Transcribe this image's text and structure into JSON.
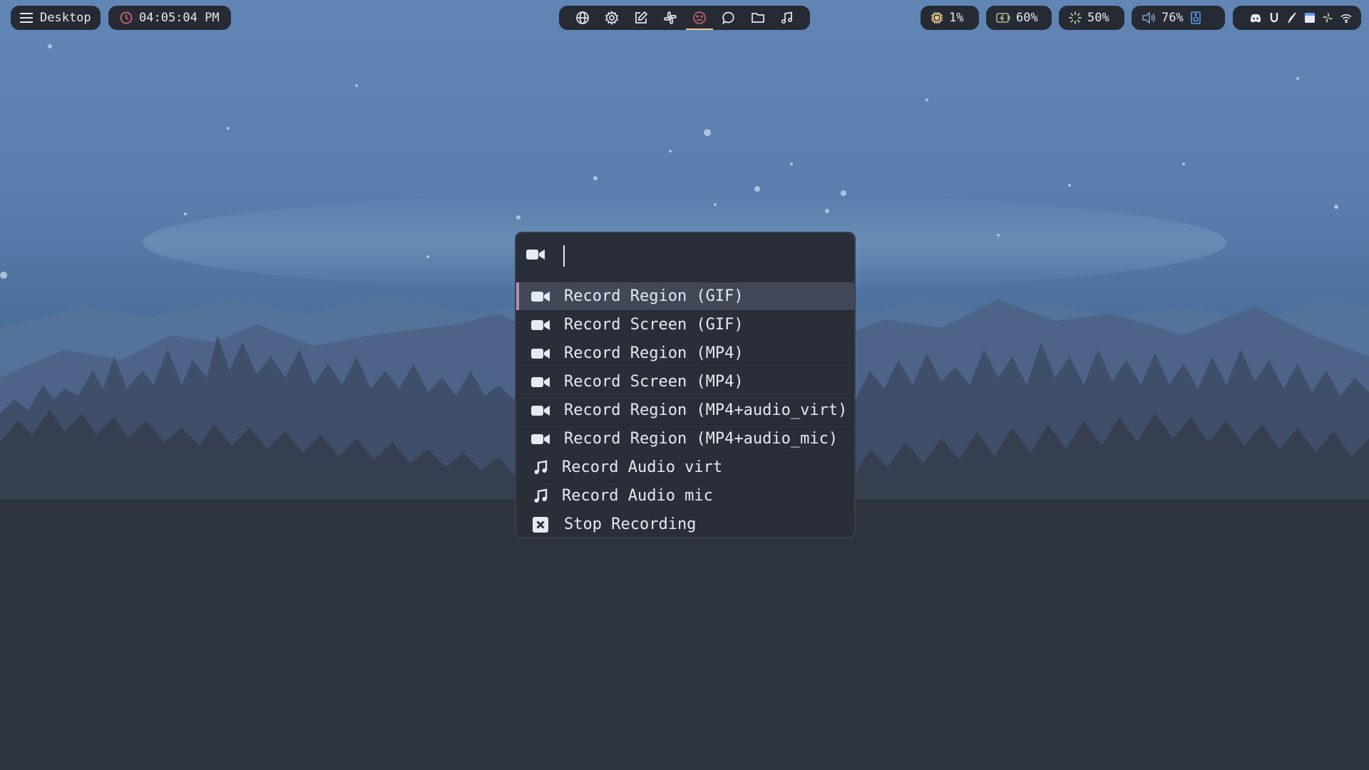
{
  "colors": {
    "sky_top": "#5f84b4",
    "sky_mid": "#4a6d9a",
    "bar_bg": "#252a35",
    "menu_bg": "#2a2e39",
    "menu_selected": "#434858",
    "menu_accent": "#b48ead",
    "active_underline": "#ebcb8b",
    "cpu_icon": "#ebcb8b",
    "battery_icon": "#a3be8c",
    "brightness_icon": "#a3be8c",
    "volume_icon": "#81a1c1",
    "clock_icon": "#bf616a"
  },
  "topbar": {
    "workspace": {
      "icon": "hamburger-icon",
      "label": "Desktop"
    },
    "clock": {
      "icon": "clock-icon",
      "time": "04:05:04 PM"
    },
    "launchers": [
      {
        "icon": "globe-icon"
      },
      {
        "icon": "gear-icon"
      },
      {
        "icon": "edit-icon"
      },
      {
        "icon": "slack-icon"
      },
      {
        "icon": "frown-face-icon",
        "active": true
      },
      {
        "icon": "chat-bubble-icon"
      },
      {
        "icon": "folder-icon"
      },
      {
        "icon": "music-note-icon"
      }
    ],
    "cpu": {
      "icon": "cpu-chip-icon",
      "value": "1%"
    },
    "battery": {
      "icon": "battery-charging-icon",
      "value": "60%"
    },
    "brightness": {
      "icon": "brightness-icon",
      "value": "50%"
    },
    "volume": {
      "icon": "speaker-icon",
      "value": "76%",
      "extra_icon": "speaker-device-icon"
    },
    "tray": [
      "discord-icon",
      "magnet-icon",
      "leaf-icon",
      "window-icon",
      "pinwheel-icon",
      "wifi-icon"
    ]
  },
  "menu": {
    "prompt_icon": "video-camera-icon",
    "search_value": "",
    "selected_index": 0,
    "items": [
      {
        "icon": "video-camera-icon",
        "label": "Record Region (GIF)"
      },
      {
        "icon": "video-camera-icon",
        "label": "Record Screen (GIF)"
      },
      {
        "icon": "video-camera-icon",
        "label": "Record Region (MP4)"
      },
      {
        "icon": "video-camera-icon",
        "label": "Record Screen (MP4)"
      },
      {
        "icon": "video-camera-icon",
        "label": "Record Region (MP4+audio_virt)"
      },
      {
        "icon": "video-camera-icon",
        "label": "Record Region (MP4+audio_mic)"
      },
      {
        "icon": "music-note-icon",
        "label": "Record Audio virt"
      },
      {
        "icon": "music-note-icon",
        "label": "Record Audio mic"
      },
      {
        "icon": "close-box-icon",
        "label": "Stop Recording"
      }
    ]
  }
}
